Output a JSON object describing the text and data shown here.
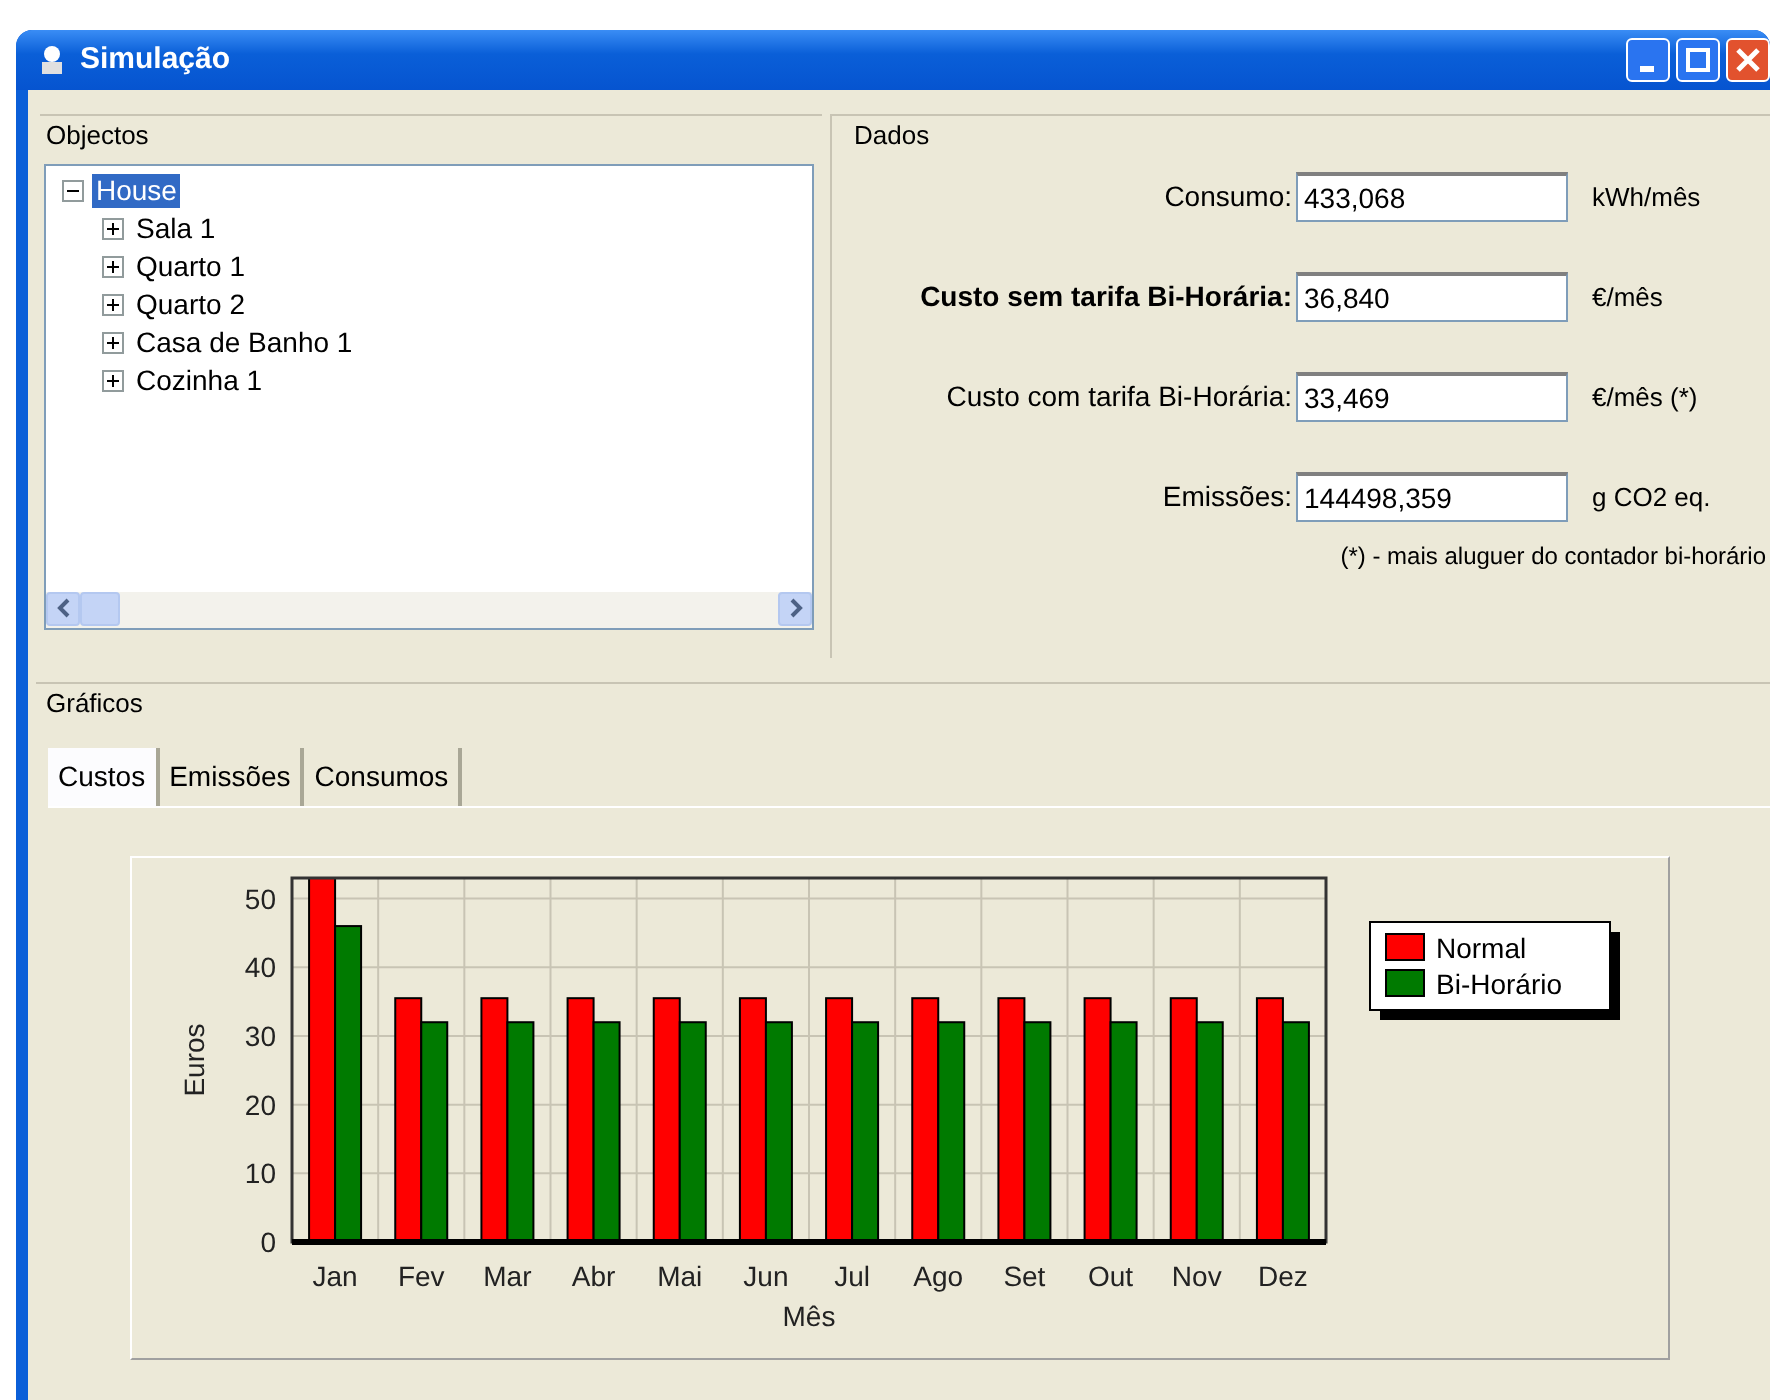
{
  "window": {
    "title": "Simulação"
  },
  "objects": {
    "title": "Objectos",
    "tree": [
      {
        "label": "House",
        "expanded": true,
        "selected": true,
        "children": [
          {
            "label": "Sala 1",
            "expanded": false,
            "selected": false
          },
          {
            "label": "Quarto 1",
            "expanded": false,
            "selected": false
          },
          {
            "label": "Quarto 2",
            "expanded": false,
            "selected": false
          },
          {
            "label": "Casa de Banho 1",
            "expanded": false,
            "selected": false
          },
          {
            "label": "Cozinha 1",
            "expanded": false,
            "selected": false
          }
        ]
      }
    ]
  },
  "data": {
    "title": "Dados",
    "fields": [
      {
        "label": "Consumo:",
        "value": "433,068",
        "unit": "kWh/mês",
        "emphasized": false
      },
      {
        "label": "Custo sem tarifa Bi-Horária:",
        "value": "36,840",
        "unit": "€/mês",
        "emphasized": true
      },
      {
        "label": "Custo com tarifa Bi-Horária:",
        "value": "33,469",
        "unit": "€/mês (*)",
        "emphasized": false
      },
      {
        "label": "Emissões:",
        "value": "144498,359",
        "unit": "g CO2 eq.",
        "emphasized": false
      }
    ],
    "note": "(*) - mais aluguer do contador bi-horário"
  },
  "charts": {
    "title": "Gráficos",
    "tabs": [
      {
        "label": "Custos",
        "selected": true
      },
      {
        "label": "Emissões",
        "selected": false
      },
      {
        "label": "Consumos",
        "selected": false
      }
    ],
    "chart_data": {
      "type": "bar",
      "xlabel": "Mês",
      "ylabel": "Euros",
      "categories": [
        "Jan",
        "Fev",
        "Mar",
        "Abr",
        "Mai",
        "Jun",
        "Jul",
        "Ago",
        "Set",
        "Out",
        "Nov",
        "Dez"
      ],
      "series": [
        {
          "name": "Normal",
          "color": "#ff0000",
          "values": [
            53,
            35.5,
            35.5,
            35.5,
            35.5,
            35.5,
            35.5,
            35.5,
            35.5,
            35.5,
            35.5,
            35.5
          ]
        },
        {
          "name": "Bi-Horário",
          "color": "#007a00",
          "values": [
            46,
            32,
            32,
            32,
            32,
            32,
            32,
            32,
            32,
            32,
            32,
            32
          ]
        }
      ],
      "ylim": [
        0,
        53
      ],
      "yticks": [
        0,
        10,
        20,
        30,
        40,
        50
      ],
      "grid": true,
      "legend": true
    }
  }
}
